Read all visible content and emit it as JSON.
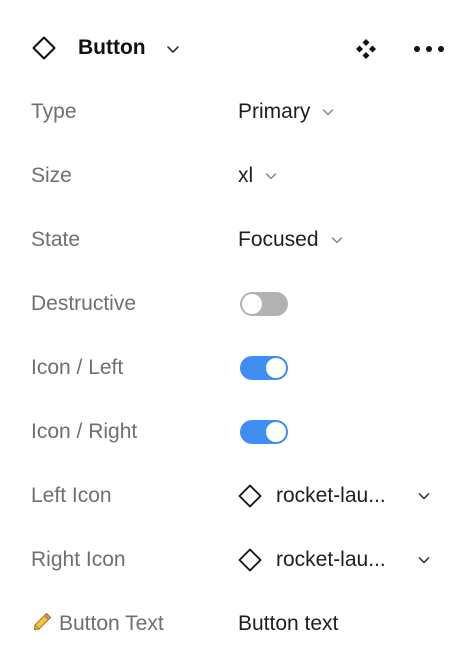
{
  "header": {
    "title": "Button",
    "component_icon": "diamond-icon",
    "actions": [
      "components-icon",
      "more-icon"
    ]
  },
  "properties": {
    "type": {
      "label": "Type",
      "value": "Primary"
    },
    "size": {
      "label": "Size",
      "value": "xl"
    },
    "state": {
      "label": "State",
      "value": "Focused"
    },
    "destructive": {
      "label": "Destructive",
      "checked": false
    },
    "icon_left": {
      "label": "Icon / Left",
      "checked": true
    },
    "icon_right": {
      "label": "Icon / Right",
      "checked": true
    },
    "left_icon": {
      "label": "Left Icon",
      "value": "rocket-lau..."
    },
    "right_icon": {
      "label": "Right Icon",
      "value": "rocket-lau..."
    },
    "button_text": {
      "label": "Button Text",
      "value": "Button text",
      "label_icon": "pencil-icon"
    }
  },
  "colors": {
    "toggle_on": "#3d8ff5",
    "toggle_off": "#b3b3b3",
    "label": "#6f6f6f",
    "value": "#1e1e1e"
  }
}
